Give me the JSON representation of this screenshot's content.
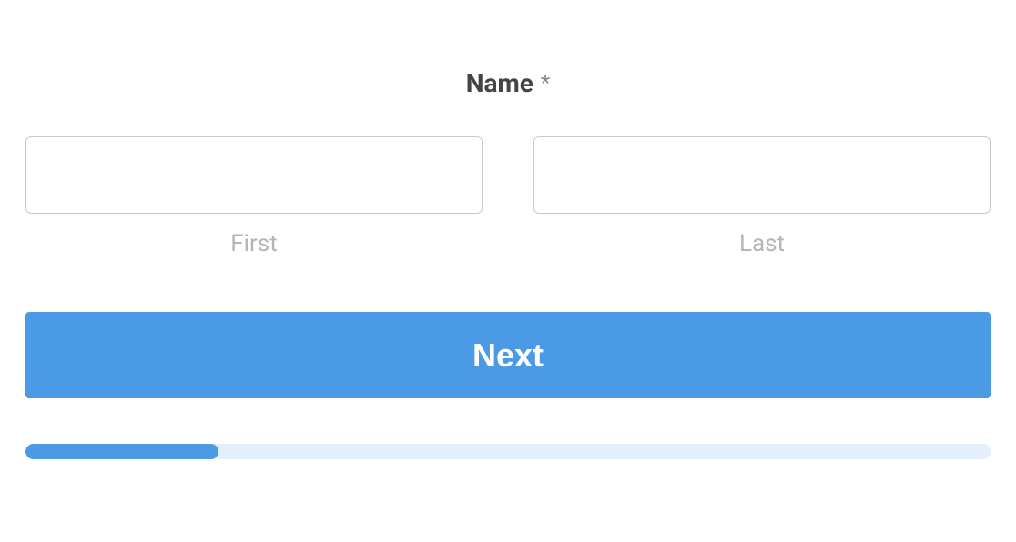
{
  "form": {
    "field_label": "Name",
    "required_mark": "*",
    "first": {
      "value": "",
      "sub_label": "First"
    },
    "last": {
      "value": "",
      "sub_label": "Last"
    },
    "next_button_label": "Next",
    "progress_percent": 20
  }
}
